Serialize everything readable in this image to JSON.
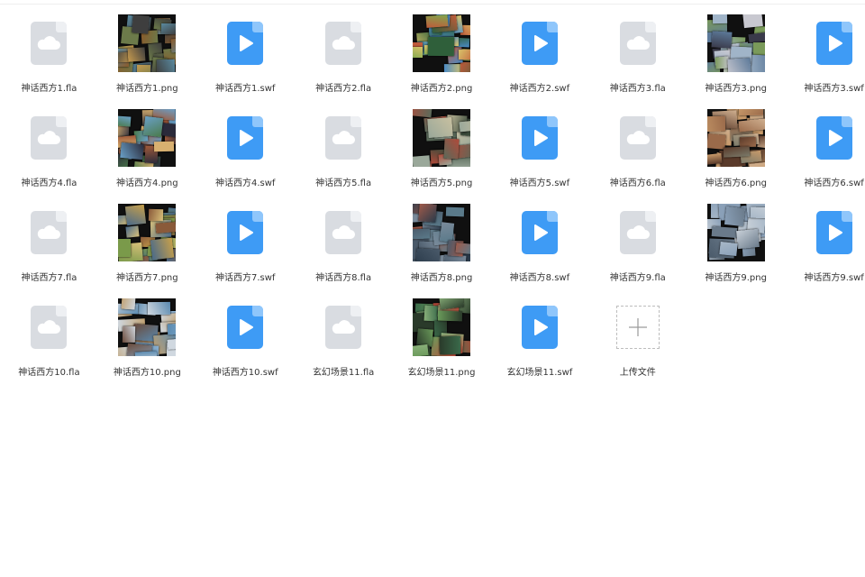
{
  "files": [
    {
      "name": "神话西方1.fla",
      "type": "fla",
      "icon": "cloud-file-icon"
    },
    {
      "name": "神话西方1.png",
      "type": "png",
      "icon": "image-thumbnail",
      "palette": [
        "#8a5a2a",
        "#6c7a4a",
        "#3e3e3e",
        "#c79b4f",
        "#5a8aa0"
      ]
    },
    {
      "name": "神话西方1.swf",
      "type": "swf",
      "icon": "play-file-icon"
    },
    {
      "name": "神话西方2.fla",
      "type": "fla",
      "icon": "cloud-file-icon"
    },
    {
      "name": "神话西方2.png",
      "type": "png",
      "icon": "image-thumbnail",
      "palette": [
        "#7fa84e",
        "#4a8bc7",
        "#d9c36a",
        "#2f5f3a",
        "#c05a3a"
      ]
    },
    {
      "name": "神话西方2.swf",
      "type": "swf",
      "icon": "play-file-icon"
    },
    {
      "name": "神话西方3.fla",
      "type": "fla",
      "icon": "cloud-file-icon"
    },
    {
      "name": "神话西方3.png",
      "type": "png",
      "icon": "image-thumbnail",
      "palette": [
        "#5d7a9a",
        "#a0b4c8",
        "#3a3a4a",
        "#7a9a5a",
        "#c8c8d0"
      ]
    },
    {
      "name": "神话西方3.swf",
      "type": "swf",
      "icon": "play-file-icon"
    },
    {
      "name": "神话西方4.fla",
      "type": "fla",
      "icon": "cloud-file-icon"
    },
    {
      "name": "神话西方4.png",
      "type": "png",
      "icon": "image-thumbnail",
      "palette": [
        "#6aa0c8",
        "#d8b070",
        "#4a7a4a",
        "#a05a3a",
        "#2a2a3a"
      ]
    },
    {
      "name": "神话西方4.swf",
      "type": "swf",
      "icon": "play-file-icon"
    },
    {
      "name": "神话西方5.fla",
      "type": "fla",
      "icon": "cloud-file-icon"
    },
    {
      "name": "神话西方5.png",
      "type": "png",
      "icon": "image-thumbnail",
      "palette": [
        "#9aa89a",
        "#5a6a5a",
        "#c8c0a0",
        "#3a4a3a",
        "#b04a3a"
      ]
    },
    {
      "name": "神话西方5.swf",
      "type": "swf",
      "icon": "play-file-icon"
    },
    {
      "name": "神话西方6.fla",
      "type": "fla",
      "icon": "cloud-file-icon"
    },
    {
      "name": "神话西方6.png",
      "type": "png",
      "icon": "image-thumbnail",
      "palette": [
        "#9a6a4a",
        "#c89a6a",
        "#5a3a2a",
        "#7a7a6a",
        "#d0b090"
      ]
    },
    {
      "name": "神话西方6.swf",
      "type": "swf",
      "icon": "play-file-icon"
    },
    {
      "name": "神话西方7.fla",
      "type": "fla",
      "icon": "cloud-file-icon"
    },
    {
      "name": "神话西方7.png",
      "type": "png",
      "icon": "image-thumbnail",
      "palette": [
        "#c8a04a",
        "#7a9a4a",
        "#8a5a3a",
        "#4a6a8a",
        "#d8c07a"
      ]
    },
    {
      "name": "神话西方7.swf",
      "type": "swf",
      "icon": "play-file-icon"
    },
    {
      "name": "神话西方8.fla",
      "type": "fla",
      "icon": "cloud-file-icon"
    },
    {
      "name": "神话西方8.png",
      "type": "png",
      "icon": "image-thumbnail",
      "palette": [
        "#4a5a6a",
        "#7a8a9a",
        "#2a3a4a",
        "#a05a4a",
        "#5a7a8a"
      ]
    },
    {
      "name": "神话西方8.swf",
      "type": "swf",
      "icon": "play-file-icon"
    },
    {
      "name": "神话西方9.fla",
      "type": "fla",
      "icon": "cloud-file-icon"
    },
    {
      "name": "神话西方9.png",
      "type": "png",
      "icon": "image-thumbnail",
      "palette": [
        "#8aa0b8",
        "#c8d0d8",
        "#4a5a6a",
        "#6a7a8a",
        "#a8b8c8"
      ]
    },
    {
      "name": "神话西方9.swf",
      "type": "swf",
      "icon": "play-file-icon"
    },
    {
      "name": "神话西方10.fla",
      "type": "fla",
      "icon": "cloud-file-icon"
    },
    {
      "name": "神话西方10.png",
      "type": "png",
      "icon": "image-thumbnail",
      "palette": [
        "#5a8ab0",
        "#c0a070",
        "#8ab0d0",
        "#d0d8e0",
        "#6a4a3a"
      ]
    },
    {
      "name": "神话西方10.swf",
      "type": "swf",
      "icon": "play-file-icon"
    },
    {
      "name": "玄幻场景11.fla",
      "type": "fla",
      "icon": "cloud-file-icon"
    },
    {
      "name": "玄幻场景11.png",
      "type": "png",
      "icon": "image-thumbnail",
      "palette": [
        "#3a6a4a",
        "#6a9a5a",
        "#2a3a2a",
        "#c04a3a",
        "#8ab07a"
      ]
    },
    {
      "name": "玄幻场景11.swf",
      "type": "swf",
      "icon": "play-file-icon"
    }
  ],
  "upload": {
    "label": "上传文件",
    "icon": "plus-icon"
  },
  "colors": {
    "swf": "#3e9bf5",
    "fla": "#d9dce1",
    "label": "#333333"
  }
}
